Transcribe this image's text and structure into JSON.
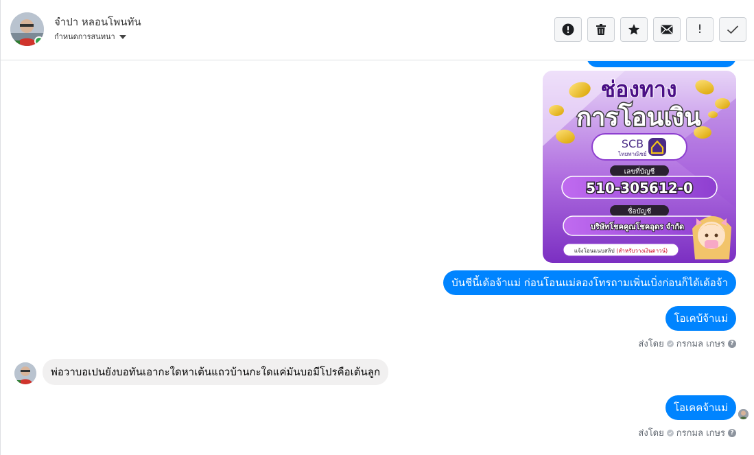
{
  "header": {
    "contact_name": "จำปา หลอนโพนทัน",
    "subtitle": "กำหนดการสนทนา",
    "toolbar": {
      "spam_label": "!",
      "mark_done_label": "✓"
    }
  },
  "bank_card": {
    "title_line1": "ช่องทาง",
    "title_line2": "การโอนเงิน",
    "bank_name": "SCB",
    "bank_subname": "ไทยพาณิชย์",
    "account_number_label": "เลขที่บัญชี",
    "account_number": "510-305612-0",
    "account_name_label": "ชื่อบัญชี",
    "account_name": "บริษัทโชคคูณโชคอุดร จำกัด",
    "footer_prefix": "แจ้งโอนแนบสลิป",
    "footer_highlight": "(สำหรับวางเงินดาวน์)"
  },
  "messages": {
    "msg1": "บันชีนี้เด้อจ้าแม่ ก่อนโอนแม่ลองโทรถามเพิ่นเบิ่งก่อนก็ได้เด้อจ้า",
    "msg2": "โอเคบ้จ้าแม่",
    "seen1_prefix": "ส่งโดย",
    "seen1_name": "กรกมล เกษร",
    "msg3": "พ่อวาบอเปนยังบอทันเอากะใดหาเต้นแถวบ้านกะใดแค่มันบอมีโปรคือเต้นลูก",
    "msg4": "โอเคคจ้าแม่",
    "seen2_prefix": "ส่งโดย",
    "seen2_name": "กรกมล เกษร"
  },
  "colors": {
    "outgoing_bubble": "#0084ff",
    "incoming_bubble": "#f1f0f0",
    "card_purple": "#8e3fd0",
    "card_accent": "#f5c518"
  },
  "icons": {
    "report": "exclamation-circle-icon",
    "delete": "trash-icon",
    "star": "star-icon",
    "mail": "envelope-icon",
    "spam": "exclamation-icon",
    "done": "check-icon"
  }
}
